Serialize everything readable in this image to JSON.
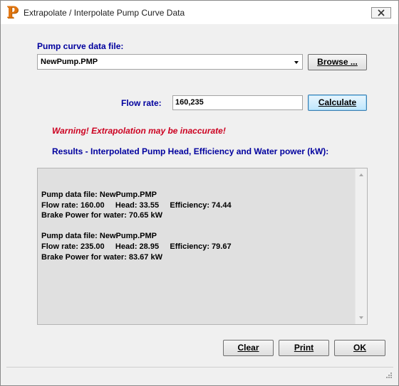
{
  "window": {
    "title": "Extrapolate / Interpolate Pump Curve Data",
    "app_icon_letter": "P",
    "close_icon": "close-icon"
  },
  "file": {
    "label": "Pump curve data file:",
    "selected": "NewPump.PMP",
    "browse_label": "Browse ..."
  },
  "flow": {
    "label": "Flow rate:",
    "value": "160,235",
    "calculate_label": "Calculate"
  },
  "warning": "Warning!  Extrapolation may be inaccurate!",
  "results": {
    "heading": "Results - Interpolated Pump Head, Efficiency and Water power (kW):",
    "lines": [
      "Pump data file: NewPump.PMP",
      "Flow rate: 160.00     Head: 33.55     Efficiency: 74.44",
      "Brake Power for water: 70.65 kW",
      "",
      "Pump data file: NewPump.PMP",
      "Flow rate: 235.00     Head: 28.95     Efficiency: 79.67",
      "Brake Power for water: 83.67 kW"
    ]
  },
  "buttons": {
    "clear": "Clear",
    "print": "Print",
    "ok": "OK"
  },
  "colors": {
    "label_blue": "#00009e",
    "warning_red": "#cc0020",
    "app_icon": "#e2750f"
  }
}
